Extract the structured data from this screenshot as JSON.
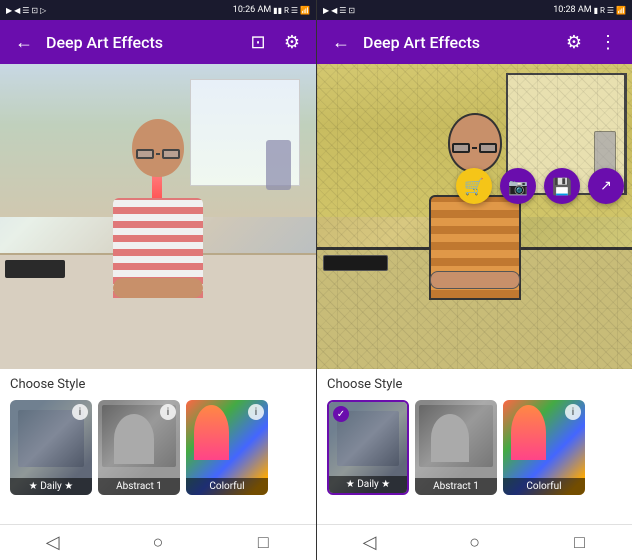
{
  "panels": [
    {
      "id": "left",
      "statusBar": {
        "time": "10:26 AM",
        "icons": "● ● ▶ ◀ ☰"
      },
      "appBar": {
        "backLabel": "←",
        "title": "Deep Art Effects",
        "cropIcon": "⊡",
        "settingsIcon": "⚙"
      },
      "bottomSection": {
        "chooseStyleLabel": "Choose Style",
        "styles": [
          {
            "id": "daily",
            "label": "★ Daily ★",
            "hasInfo": true,
            "selected": false
          },
          {
            "id": "abstract1",
            "label": "Abstract 1",
            "hasInfo": true,
            "selected": false
          },
          {
            "id": "colorful",
            "label": "Colorful",
            "hasInfo": true,
            "selected": false
          }
        ]
      },
      "navBar": {
        "backIcon": "◁",
        "homeIcon": "○",
        "recentsIcon": "□"
      }
    },
    {
      "id": "right",
      "statusBar": {
        "time": "10:28 AM",
        "icons": "● ● ☰"
      },
      "appBar": {
        "backLabel": "←",
        "title": "Deep Art Effects",
        "settingsIcon": "⚙",
        "moreIcon": "⋮"
      },
      "fabButtons": [
        {
          "id": "cart",
          "icon": "🛒",
          "type": "cart"
        },
        {
          "id": "instagram",
          "icon": "📷",
          "type": "instagram"
        },
        {
          "id": "save",
          "icon": "💾",
          "type": "save"
        },
        {
          "id": "share",
          "icon": "↗",
          "type": "share"
        }
      ],
      "bottomSection": {
        "chooseStyleLabel": "Choose Style",
        "styles": [
          {
            "id": "daily",
            "label": "★ Daily ★",
            "hasInfo": false,
            "selected": true
          },
          {
            "id": "abstract1",
            "label": "Abstract 1",
            "hasInfo": false,
            "selected": false
          },
          {
            "id": "colorful",
            "label": "Colorful",
            "hasInfo": true,
            "selected": false
          }
        ]
      },
      "navBar": {
        "backIcon": "◁",
        "homeIcon": "○",
        "recentsIcon": "□"
      }
    }
  ],
  "colors": {
    "appBarBg": "#6a0dad",
    "selectedBorder": "#6a0dad",
    "fabCart": "#f5c518",
    "fabPurple": "#6a0dad"
  }
}
